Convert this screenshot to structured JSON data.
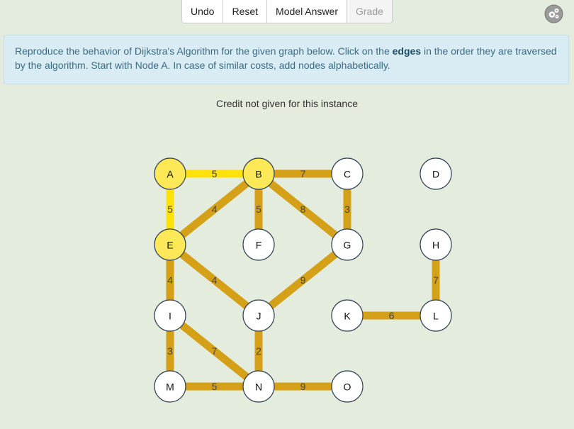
{
  "toolbar": {
    "undo": "Undo",
    "reset": "Reset",
    "model_answer": "Model Answer",
    "grade": "Grade"
  },
  "settings_icon": "gear-icon",
  "instructions": {
    "part1": "Reproduce the behavior of Dijkstra's Algorithm for the given graph below. Click on the ",
    "bold": "edges",
    "part2": " in the order they are traversed by the algorithm. Start with Node A. In case of similar costs, add nodes alphabetically."
  },
  "status": "Credit not given for this instance",
  "colors": {
    "edge": "#d4a017",
    "edge_visited": "#ffe20a",
    "node_visited": "#fde858",
    "node": "#ffffff"
  },
  "graph": {
    "nodes": [
      {
        "id": "A",
        "visited": true
      },
      {
        "id": "B",
        "visited": true
      },
      {
        "id": "C",
        "visited": false
      },
      {
        "id": "D",
        "visited": false
      },
      {
        "id": "E",
        "visited": true
      },
      {
        "id": "F",
        "visited": false
      },
      {
        "id": "G",
        "visited": false
      },
      {
        "id": "H",
        "visited": false
      },
      {
        "id": "I",
        "visited": false
      },
      {
        "id": "J",
        "visited": false
      },
      {
        "id": "K",
        "visited": false
      },
      {
        "id": "L",
        "visited": false
      },
      {
        "id": "M",
        "visited": false
      },
      {
        "id": "N",
        "visited": false
      },
      {
        "id": "O",
        "visited": false
      }
    ],
    "edges": [
      {
        "from": "A",
        "to": "B",
        "weight": "5",
        "visited": true
      },
      {
        "from": "A",
        "to": "E",
        "weight": "5",
        "visited": true
      },
      {
        "from": "B",
        "to": "C",
        "weight": "7",
        "visited": false
      },
      {
        "from": "B",
        "to": "E",
        "weight": "4",
        "visited": false
      },
      {
        "from": "B",
        "to": "F",
        "weight": "5",
        "visited": false
      },
      {
        "from": "B",
        "to": "G",
        "weight": "8",
        "visited": false
      },
      {
        "from": "C",
        "to": "G",
        "weight": "3",
        "visited": false
      },
      {
        "from": "E",
        "to": "I",
        "weight": "4",
        "visited": false
      },
      {
        "from": "E",
        "to": "J",
        "weight": "4",
        "visited": false
      },
      {
        "from": "G",
        "to": "J",
        "weight": "9",
        "visited": false
      },
      {
        "from": "H",
        "to": "L",
        "weight": "7",
        "visited": false
      },
      {
        "from": "I",
        "to": "M",
        "weight": "3",
        "visited": false
      },
      {
        "from": "I",
        "to": "N",
        "weight": "7",
        "visited": false
      },
      {
        "from": "J",
        "to": "N",
        "weight": "2",
        "visited": false
      },
      {
        "from": "K",
        "to": "L",
        "weight": "6",
        "visited": false
      },
      {
        "from": "M",
        "to": "N",
        "weight": "5",
        "visited": false
      },
      {
        "from": "N",
        "to": "O",
        "weight": "9",
        "visited": false
      }
    ]
  }
}
